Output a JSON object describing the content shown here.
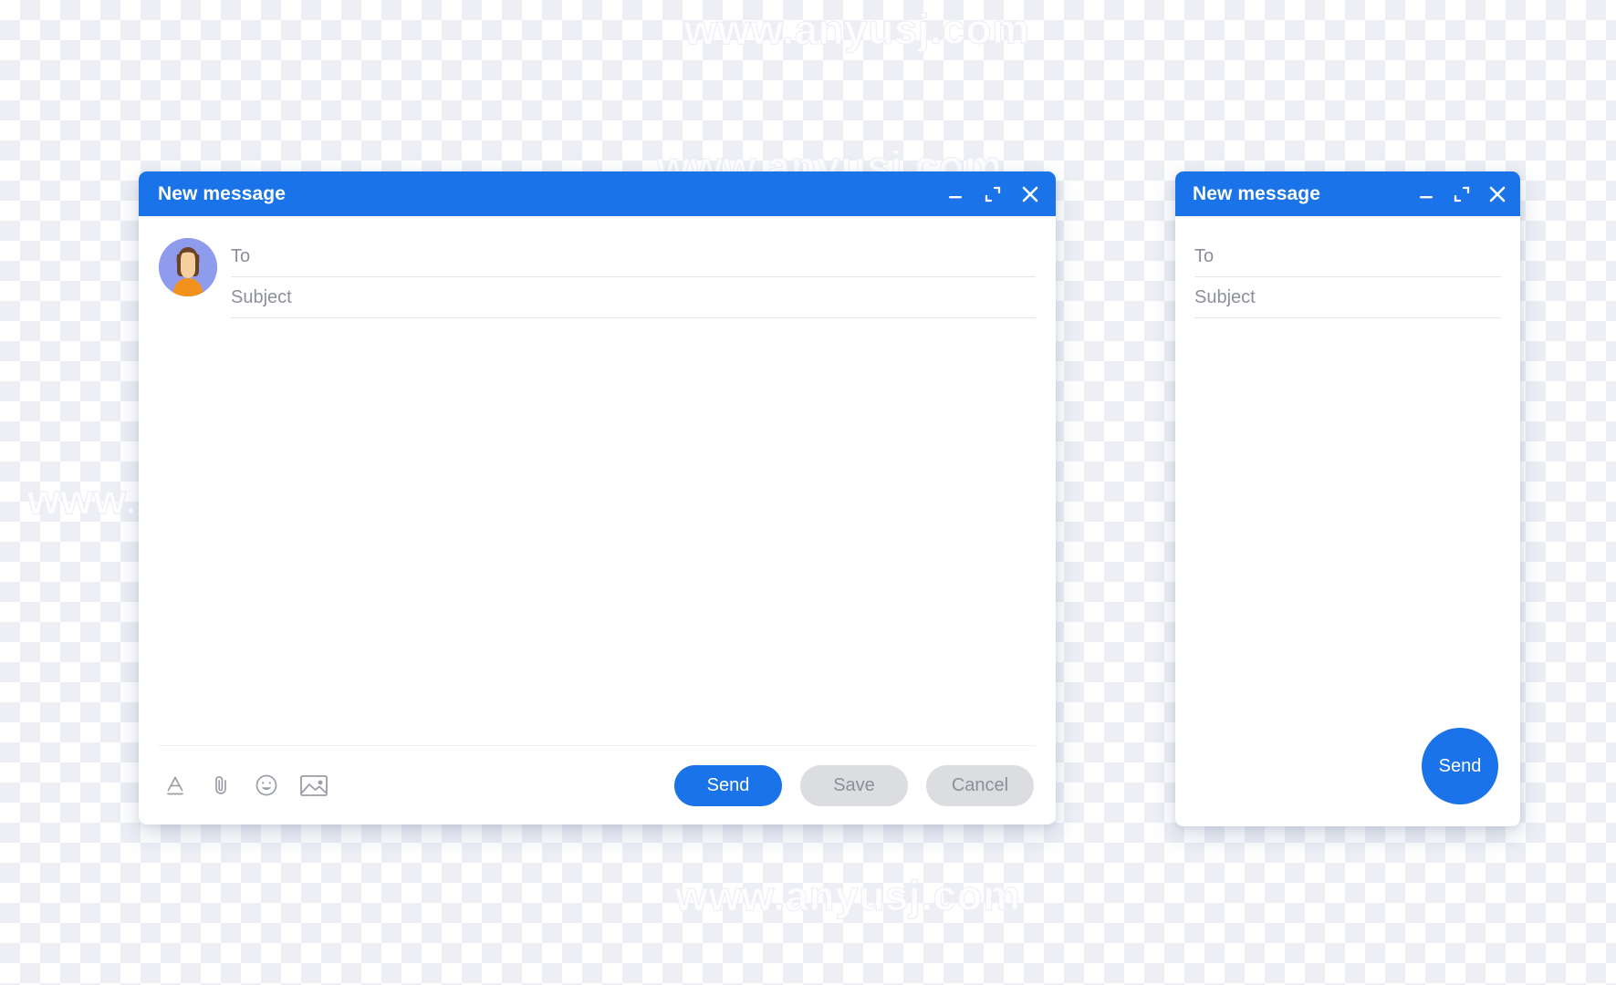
{
  "background": {
    "type": "transparency-checkerboard",
    "light_color": "#ffffff",
    "dark_color": "#edeff5",
    "square_size_px": 22
  },
  "watermark": {
    "text": "www.anyusj.com",
    "color": "#ffffff",
    "occurrences": 9
  },
  "theme": {
    "accent_blue": "#1a73e8",
    "muted_button_bg": "#dcdde1",
    "muted_button_text": "#8b8f97",
    "placeholder_text": "#8b8f97",
    "field_underline": "#e4e6ea",
    "icon_gray": "#9a9ea6",
    "window_bg": "#ffffff"
  },
  "windows": [
    {
      "id": "compose-large",
      "title": "New message",
      "has_avatar": true,
      "controls": [
        {
          "name": "minimize",
          "glyph": "minimize-icon"
        },
        {
          "name": "expand",
          "glyph": "expand-icon"
        },
        {
          "name": "close",
          "glyph": "close-icon"
        }
      ],
      "fields": [
        {
          "name": "to",
          "placeholder": "To",
          "value": ""
        },
        {
          "name": "subject",
          "placeholder": "Subject",
          "value": ""
        }
      ],
      "body_value": "",
      "toolbar_icons": [
        {
          "name": "text-format-icon",
          "label": "Text format"
        },
        {
          "name": "attachment-icon",
          "label": "Attach file"
        },
        {
          "name": "emoji-icon",
          "label": "Insert emoji"
        },
        {
          "name": "image-icon",
          "label": "Insert image"
        }
      ],
      "buttons": [
        {
          "name": "send",
          "label": "Send",
          "style": "primary"
        },
        {
          "name": "save",
          "label": "Save",
          "style": "muted"
        },
        {
          "name": "cancel",
          "label": "Cancel",
          "style": "muted"
        }
      ]
    },
    {
      "id": "compose-compact",
      "title": "New message",
      "has_avatar": false,
      "controls": [
        {
          "name": "minimize",
          "glyph": "minimize-icon"
        },
        {
          "name": "expand",
          "glyph": "expand-icon"
        },
        {
          "name": "close",
          "glyph": "close-icon"
        }
      ],
      "fields": [
        {
          "name": "to",
          "placeholder": "To",
          "value": ""
        },
        {
          "name": "subject",
          "placeholder": "Subject",
          "value": ""
        }
      ],
      "body_value": "",
      "fab": {
        "name": "send",
        "label": "Send"
      }
    }
  ],
  "avatar": {
    "circle_color": "#8f9ced",
    "hair_color": "#6b4226",
    "skin_color": "#f5cf9e",
    "shirt_color": "#f2921d"
  }
}
